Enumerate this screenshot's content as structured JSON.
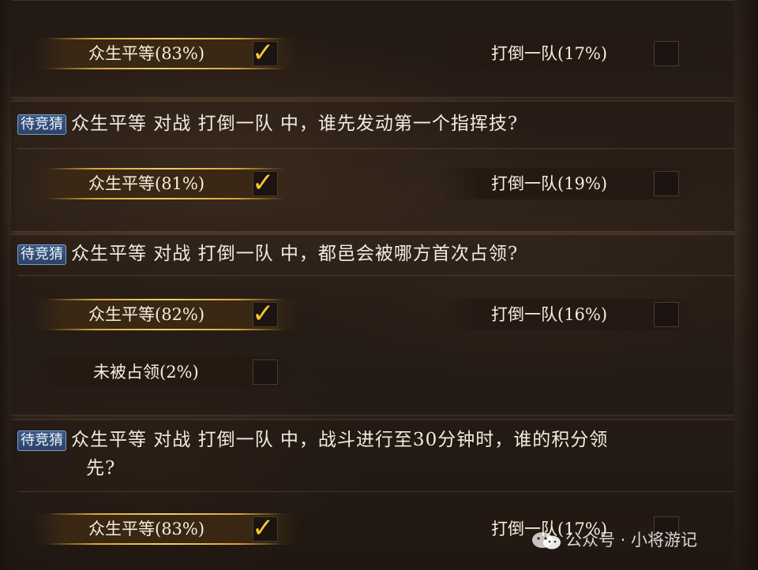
{
  "tag_label": "待竞猜",
  "check_glyph": "✓",
  "blocks": [
    {
      "options": [
        {
          "label": "众生平等(83%)",
          "selected": true
        },
        {
          "label": "打倒一队(17%)",
          "selected": false
        }
      ]
    },
    {
      "question": "众生平等 对战 打倒一队 中，谁先发动第一个指挥技?",
      "options": [
        {
          "label": "众生平等(81%)",
          "selected": true
        },
        {
          "label": "打倒一队(19%)",
          "selected": false
        }
      ]
    },
    {
      "question": "众生平等 对战 打倒一队 中，都邑会被哪方首次占领?",
      "options": [
        {
          "label": "众生平等(82%)",
          "selected": true
        },
        {
          "label": "打倒一队(16%)",
          "selected": false
        },
        {
          "label": "未被占领(2%)",
          "selected": false
        }
      ]
    },
    {
      "question_line1": "众生平等 对战 打倒一队 中，战斗进行至30分钟时，谁的积分领",
      "question_line2": "先?",
      "options": [
        {
          "label": "众生平等(83%)",
          "selected": true
        },
        {
          "label": "打倒一队(17%)",
          "selected": false
        }
      ]
    }
  ],
  "watermark": {
    "icon": "wechat-icon",
    "text": "公众号 · 小将游记"
  },
  "colors": {
    "gold": "#f3c530",
    "tag_blue": "#2b4368",
    "text": "#f4eedf"
  }
}
